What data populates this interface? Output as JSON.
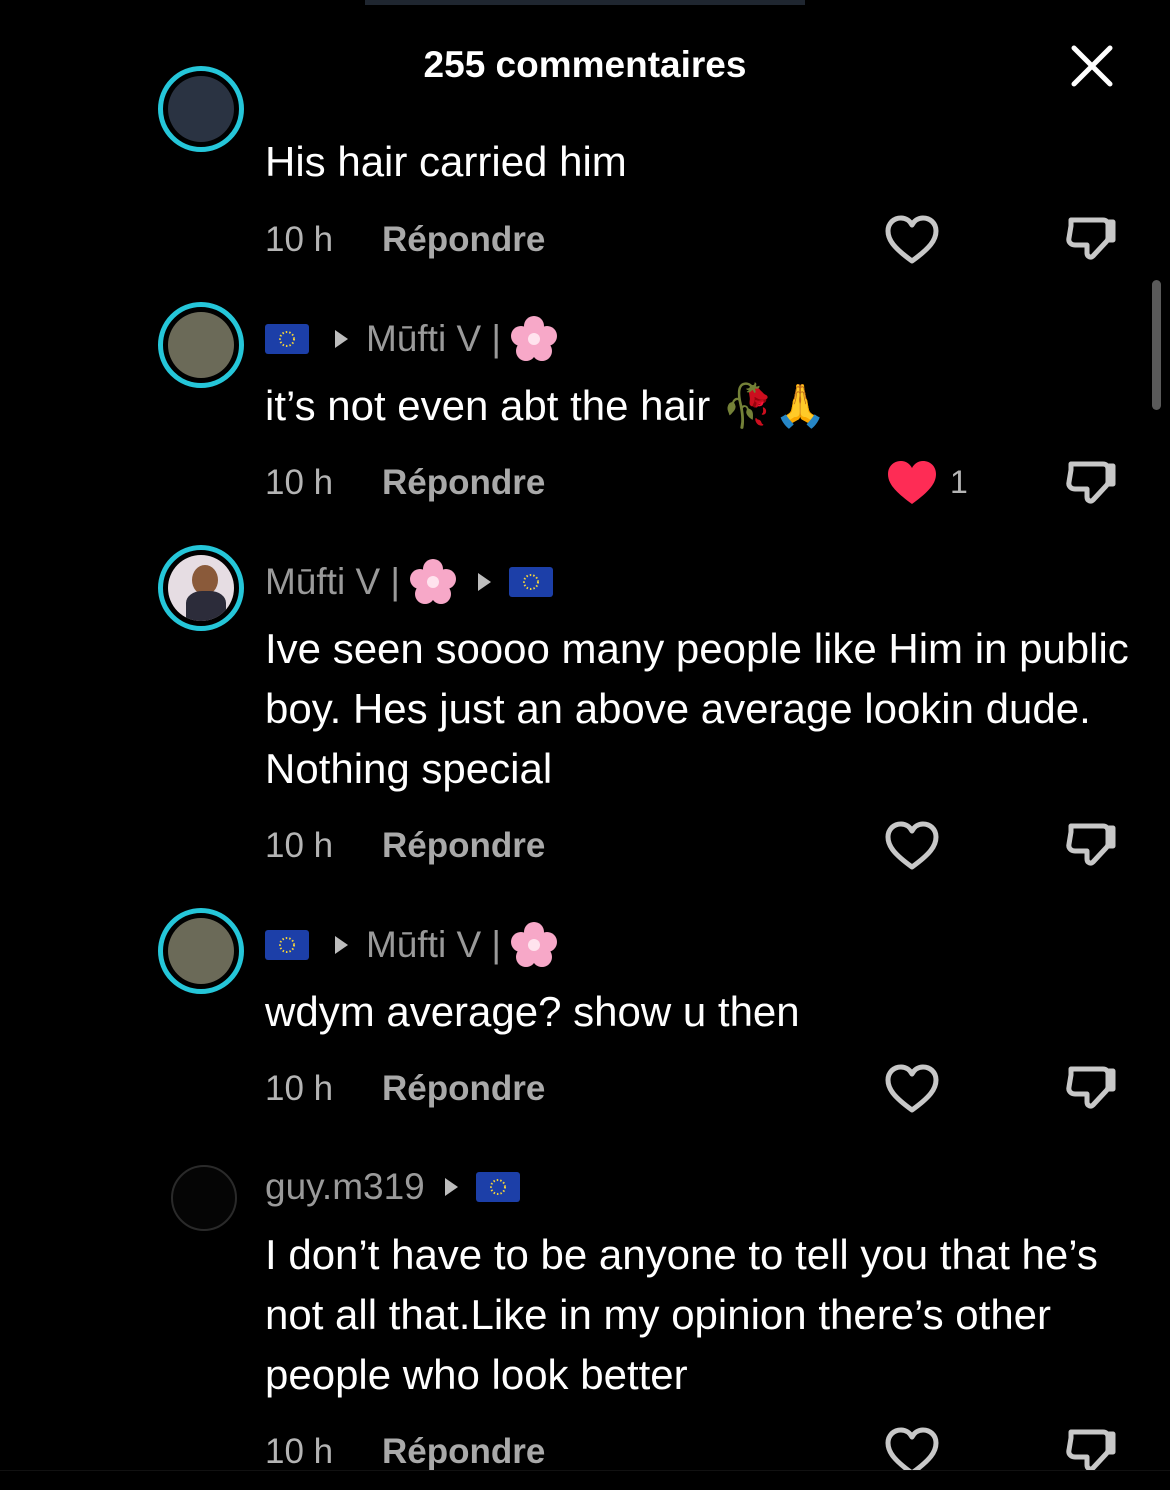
{
  "header": {
    "title": "255 commentaires"
  },
  "comments": [
    {
      "text": "His hair carried him",
      "time": "10 h",
      "reply": "Répondre"
    },
    {
      "username": "Mūfti V |",
      "text": "it’s not even abt the hair 🥀🙏",
      "time": "10 h",
      "reply": "Répondre",
      "likes": "1"
    },
    {
      "username": "Mūfti V |",
      "text": "Ive seen soooo many people like Him in public boy. Hes just an above average lookin dude. Nothing special",
      "time": "10 h",
      "reply": "Répondre"
    },
    {
      "username": "Mūfti V |",
      "text": "wdym average? show u then",
      "time": "10 h",
      "reply": "Répondre"
    },
    {
      "username": "guy.m319",
      "text": "I don’t have to be anyone to tell you that he’s not all that.Like in my opinion there’s other people who look better",
      "time": "10 h",
      "reply": "Répondre"
    }
  ],
  "colors": {
    "accent_ring": "#25c6d9",
    "liked_heart": "#fe2c55",
    "flag_blue": "#1c3fa8"
  },
  "icons": [
    "close-icon",
    "heart-outline-icon",
    "heart-filled-icon",
    "thumbs-down-icon",
    "eu-flag-icon",
    "triangle-arrow-icon",
    "cherry-blossom-icon"
  ]
}
